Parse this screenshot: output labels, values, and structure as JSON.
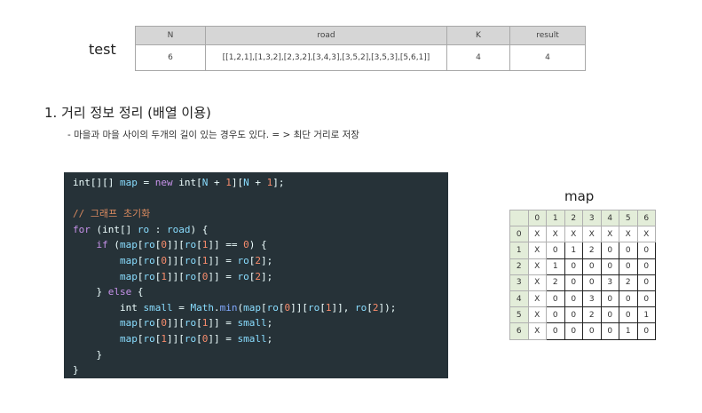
{
  "test": {
    "label": "test",
    "headers": [
      "N",
      "road",
      "K",
      "result"
    ],
    "row": [
      "6",
      "[[1,2,1],[1,3,2],[2,3,2],[3,4,3],[3,5,2],[3,5,3],[5,6,1]]",
      "4",
      "4"
    ]
  },
  "section": {
    "title": "1. 거리 정보 정리 (배열 이용)",
    "note": "- 마을과 마을 사이의 두개의 길이 있는 경우도 있다. = > 최단 거리로 저장"
  },
  "code": {
    "lines": [
      [
        [
          "int[][] ",
          "type"
        ],
        [
          "map",
          "var"
        ],
        [
          " = ",
          "op"
        ],
        [
          "new",
          "kw"
        ],
        [
          " int[",
          "type"
        ],
        [
          "N",
          "var"
        ],
        [
          " + ",
          "op"
        ],
        [
          "1",
          "num"
        ],
        [
          "][",
          "op"
        ],
        [
          "N",
          "var"
        ],
        [
          " + ",
          "op"
        ],
        [
          "1",
          "num"
        ],
        [
          "];",
          "op"
        ]
      ],
      [],
      [
        [
          "// 그래프 초기화",
          "cmt"
        ]
      ],
      [
        [
          "for",
          "kw"
        ],
        [
          " (int[] ",
          "type"
        ],
        [
          "ro",
          "var"
        ],
        [
          " : ",
          "op"
        ],
        [
          "road",
          "var"
        ],
        [
          ") {",
          "op"
        ]
      ],
      [
        [
          "    if",
          "kw"
        ],
        [
          " (",
          "op"
        ],
        [
          "map",
          "var"
        ],
        [
          "[",
          "op"
        ],
        [
          "ro",
          "var"
        ],
        [
          "[",
          "op"
        ],
        [
          "0",
          "num"
        ],
        [
          "]][",
          "op"
        ],
        [
          "ro",
          "var"
        ],
        [
          "[",
          "op"
        ],
        [
          "1",
          "num"
        ],
        [
          "]] == ",
          "op"
        ],
        [
          "0",
          "num"
        ],
        [
          ") {",
          "op"
        ]
      ],
      [
        [
          "        map",
          "var"
        ],
        [
          "[",
          "op"
        ],
        [
          "ro",
          "var"
        ],
        [
          "[",
          "op"
        ],
        [
          "0",
          "num"
        ],
        [
          "]][",
          "op"
        ],
        [
          "ro",
          "var"
        ],
        [
          "[",
          "op"
        ],
        [
          "1",
          "num"
        ],
        [
          "]] = ",
          "op"
        ],
        [
          "ro",
          "var"
        ],
        [
          "[",
          "op"
        ],
        [
          "2",
          "num"
        ],
        [
          "];",
          "op"
        ]
      ],
      [
        [
          "        map",
          "var"
        ],
        [
          "[",
          "op"
        ],
        [
          "ro",
          "var"
        ],
        [
          "[",
          "op"
        ],
        [
          "1",
          "num"
        ],
        [
          "]][",
          "op"
        ],
        [
          "ro",
          "var"
        ],
        [
          "[",
          "op"
        ],
        [
          "0",
          "num"
        ],
        [
          "]] = ",
          "op"
        ],
        [
          "ro",
          "var"
        ],
        [
          "[",
          "op"
        ],
        [
          "2",
          "num"
        ],
        [
          "];",
          "op"
        ]
      ],
      [
        [
          "    } ",
          "op"
        ],
        [
          "else",
          "kw"
        ],
        [
          " {",
          "op"
        ]
      ],
      [
        [
          "        int ",
          "type"
        ],
        [
          "small",
          "var"
        ],
        [
          " = ",
          "op"
        ],
        [
          "Math",
          "var"
        ],
        [
          ".",
          "op"
        ],
        [
          "min",
          "fn"
        ],
        [
          "(",
          "op"
        ],
        [
          "map",
          "var"
        ],
        [
          "[",
          "op"
        ],
        [
          "ro",
          "var"
        ],
        [
          "[",
          "op"
        ],
        [
          "0",
          "num"
        ],
        [
          "]][",
          "op"
        ],
        [
          "ro",
          "var"
        ],
        [
          "[",
          "op"
        ],
        [
          "1",
          "num"
        ],
        [
          "]], ",
          "op"
        ],
        [
          "ro",
          "var"
        ],
        [
          "[",
          "op"
        ],
        [
          "2",
          "num"
        ],
        [
          "]);",
          "op"
        ]
      ],
      [
        [
          "        map",
          "var"
        ],
        [
          "[",
          "op"
        ],
        [
          "ro",
          "var"
        ],
        [
          "[",
          "op"
        ],
        [
          "0",
          "num"
        ],
        [
          "]][",
          "op"
        ],
        [
          "ro",
          "var"
        ],
        [
          "[",
          "op"
        ],
        [
          "1",
          "num"
        ],
        [
          "]] = ",
          "op"
        ],
        [
          "small",
          "var"
        ],
        [
          ";",
          "op"
        ]
      ],
      [
        [
          "        map",
          "var"
        ],
        [
          "[",
          "op"
        ],
        [
          "ro",
          "var"
        ],
        [
          "[",
          "op"
        ],
        [
          "1",
          "num"
        ],
        [
          "]][",
          "op"
        ],
        [
          "ro",
          "var"
        ],
        [
          "[",
          "op"
        ],
        [
          "0",
          "num"
        ],
        [
          "]] = ",
          "op"
        ],
        [
          "small",
          "var"
        ],
        [
          ";",
          "op"
        ]
      ],
      [
        [
          "    }",
          "op"
        ]
      ],
      [
        [
          "}",
          "op"
        ]
      ]
    ]
  },
  "map": {
    "title": "map",
    "col_headers": [
      "",
      "0",
      "1",
      "2",
      "3",
      "4",
      "5",
      "6"
    ],
    "rows": [
      {
        "head": "0",
        "cells": [
          "X",
          "X",
          "X",
          "X",
          "X",
          "X",
          "X"
        ]
      },
      {
        "head": "1",
        "cells": [
          "X",
          "0",
          "1",
          "2",
          "0",
          "0",
          "0"
        ]
      },
      {
        "head": "2",
        "cells": [
          "X",
          "1",
          "0",
          "0",
          "0",
          "0",
          "0"
        ]
      },
      {
        "head": "3",
        "cells": [
          "X",
          "2",
          "0",
          "0",
          "3",
          "2",
          "0"
        ]
      },
      {
        "head": "4",
        "cells": [
          "X",
          "0",
          "0",
          "3",
          "0",
          "0",
          "0"
        ]
      },
      {
        "head": "5",
        "cells": [
          "X",
          "0",
          "0",
          "2",
          "0",
          "0",
          "1"
        ]
      },
      {
        "head": "6",
        "cells": [
          "X",
          "0",
          "0",
          "0",
          "0",
          "1",
          "0"
        ]
      }
    ]
  }
}
